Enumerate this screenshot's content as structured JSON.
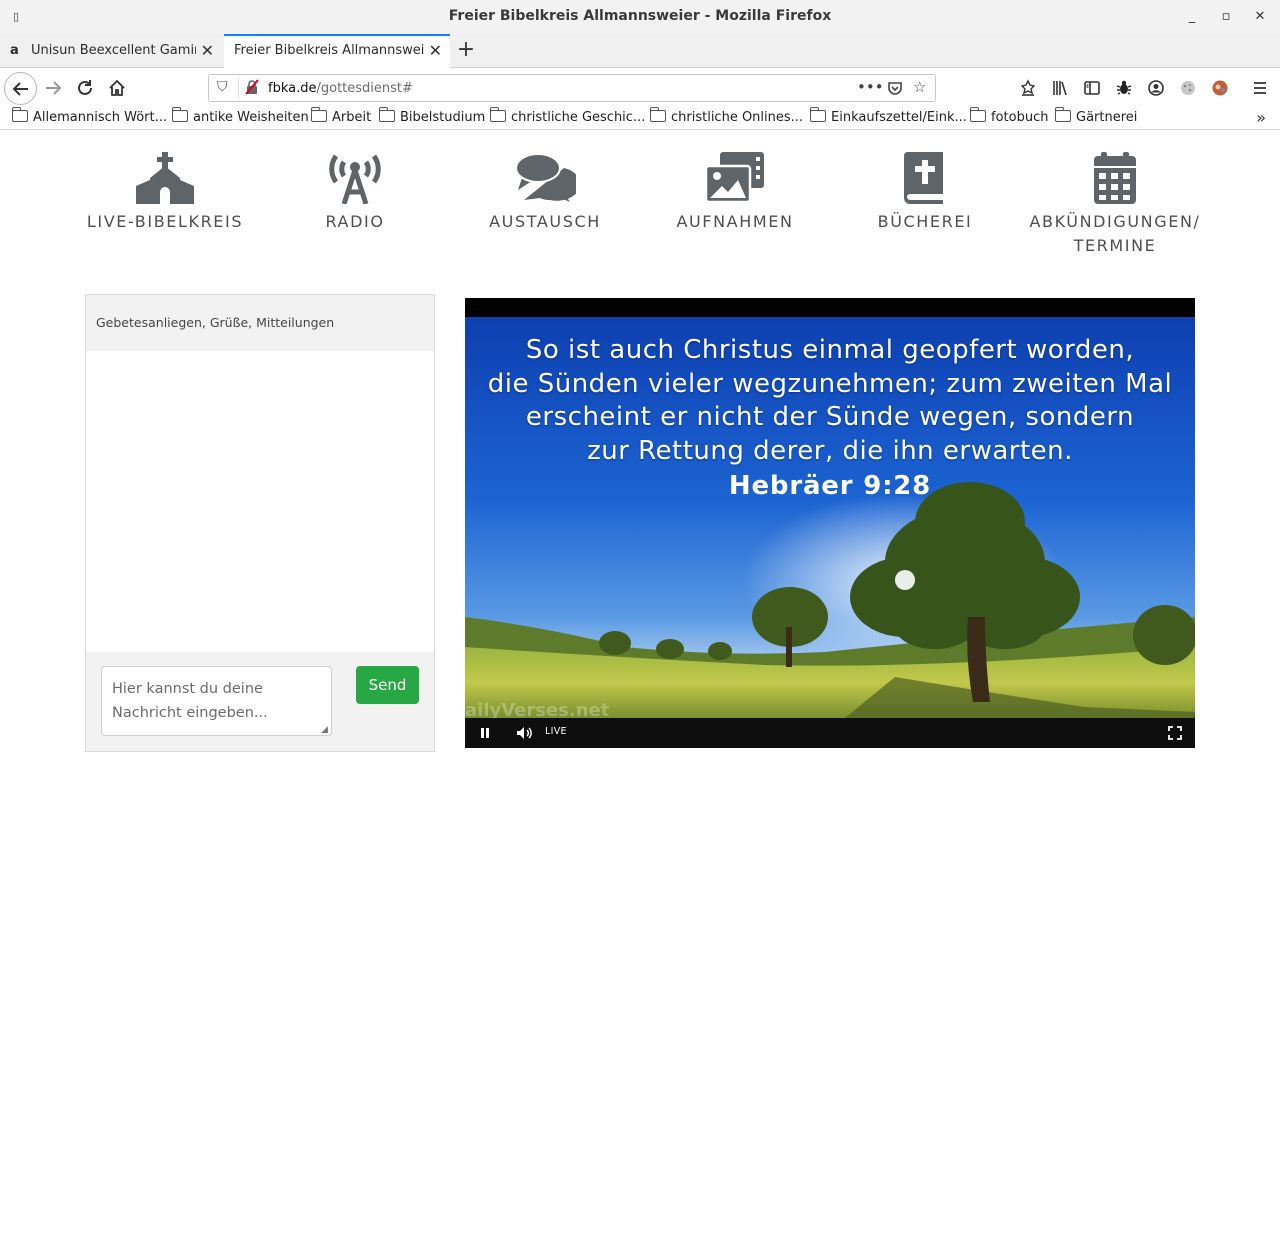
{
  "window": {
    "title": "Freier Bibelkreis Allmannsweier - Mozilla Firefox",
    "minimize": "_",
    "maximize": "▫",
    "close": "✕"
  },
  "tabs": [
    {
      "label": "Unisun Beexcellent Gaming",
      "favicon": "a",
      "close": "✕"
    },
    {
      "label": "Freier Bibelkreis Allmannsweier",
      "close": "✕"
    }
  ],
  "new_tab": "+",
  "address": {
    "host": "fbka.de",
    "path": "/gottesdienst#"
  },
  "bookmarks": [
    "Allemannisch Wört...",
    "antike Weisheiten",
    "Arbeit",
    "Bibelstudium",
    "christliche Geschic...",
    "christliche Onlines...",
    "Einkaufszettel/Eink...",
    "fotobuch",
    "Gärtnerei"
  ],
  "site_nav": [
    {
      "label": "LIVE-BIBELKREIS",
      "icon": "church-icon"
    },
    {
      "label": "RADIO",
      "icon": "broadcast-tower-icon"
    },
    {
      "label": "AUSTAUSCH",
      "icon": "comments-icon"
    },
    {
      "label": "AUFNAHMEN",
      "icon": "photo-video-icon"
    },
    {
      "label": "BÜCHEREI",
      "icon": "bible-icon"
    },
    {
      "label": "ABKÜNDIGUNGEN/",
      "label2": "TERMINE",
      "icon": "calendar-icon"
    }
  ],
  "chat": {
    "header": "Gebetesanliegen, Grüße, Mitteilungen",
    "placeholder": "Hier kannst du deine Nachricht eingeben...",
    "send_label": "Send"
  },
  "video": {
    "verse_lines": [
      "So ist auch Christus einmal geopfert worden,",
      "die Sünden vieler wegzunehmen; zum zweiten Mal",
      "erscheint er nicht der Sünde wegen, sondern",
      "zur Rettung derer, die ihn erwarten."
    ],
    "reference": "Hebräer 9:28",
    "watermark": "ailyVerses.net",
    "live_label": "LIVE"
  },
  "colors": {
    "accent_tab": "#0a84ff",
    "send_button": "#28a745",
    "nav_icon": "#5f6468"
  }
}
